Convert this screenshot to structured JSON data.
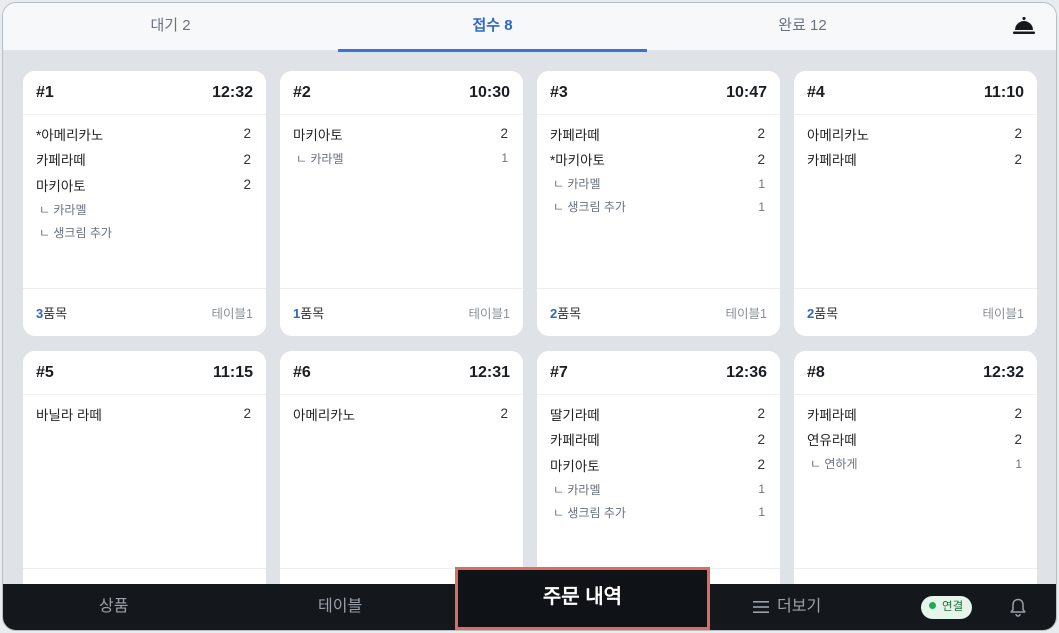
{
  "tabs": [
    {
      "label": "대기 2",
      "active": false
    },
    {
      "label": "접수 8",
      "active": true
    },
    {
      "label": "완료 12",
      "active": false
    }
  ],
  "icons": {
    "top_right": "service-bell-icon",
    "more": "menu-icon",
    "bottom_right": "bell-icon"
  },
  "colors": {
    "accent": "#2f67c4",
    "highlight_border": "#e06a5e",
    "connected": "#23a55a"
  },
  "cards": [
    {
      "no": "#1",
      "time": "12:32",
      "items": [
        {
          "name": "*아메리카노",
          "qty": "2"
        },
        {
          "name": "카페라떼",
          "qty": "2"
        },
        {
          "name": "마키아토",
          "qty": "2"
        },
        {
          "name": "ㄴ 카라멜",
          "qty": "",
          "opt": true
        },
        {
          "name": "ㄴ 생크림 추가",
          "qty": "",
          "opt": true
        }
      ],
      "count_num": "3",
      "count_unit": "품목",
      "table": "테이블1"
    },
    {
      "no": "#2",
      "time": "10:30",
      "items": [
        {
          "name": "마키아토",
          "qty": "2"
        },
        {
          "name": "ㄴ 카라멜",
          "qty": "1",
          "opt": true
        }
      ],
      "count_num": "1",
      "count_unit": "품목",
      "table": "테이블1"
    },
    {
      "no": "#3",
      "time": "10:47",
      "items": [
        {
          "name": "카페라떼",
          "qty": "2"
        },
        {
          "name": "*마키아토",
          "qty": "2"
        },
        {
          "name": "ㄴ 카라멜",
          "qty": "1",
          "opt": true
        },
        {
          "name": "ㄴ 생크림 추가",
          "qty": "1",
          "opt": true
        }
      ],
      "count_num": "2",
      "count_unit": "품목",
      "table": "테이블1"
    },
    {
      "no": "#4",
      "time": "11:10",
      "items": [
        {
          "name": "아메리카노",
          "qty": "2"
        },
        {
          "name": "카페라떼",
          "qty": "2"
        }
      ],
      "count_num": "2",
      "count_unit": "품목",
      "table": "테이블1"
    },
    {
      "no": "#5",
      "time": "11:15",
      "items": [
        {
          "name": "바닐라 라떼",
          "qty": "2"
        }
      ]
    },
    {
      "no": "#6",
      "time": "12:31",
      "items": [
        {
          "name": "아메리카노",
          "qty": "2"
        }
      ]
    },
    {
      "no": "#7",
      "time": "12:36",
      "items": [
        {
          "name": "딸기라떼",
          "qty": "2"
        },
        {
          "name": "카페라떼",
          "qty": "2"
        },
        {
          "name": "마키아토",
          "qty": "2"
        },
        {
          "name": "ㄴ 카라멜",
          "qty": "1",
          "opt": true
        },
        {
          "name": "ㄴ 생크림 추가",
          "qty": "1",
          "opt": true
        }
      ]
    },
    {
      "no": "#8",
      "time": "12:32",
      "items": [
        {
          "name": "카페라떼",
          "qty": "2"
        },
        {
          "name": "연유라떼",
          "qty": "2"
        },
        {
          "name": "ㄴ 연하게",
          "qty": "1",
          "opt": true
        }
      ]
    }
  ],
  "bottom_nav": {
    "products": "상품",
    "tables": "테이블",
    "orders": "주문 내역",
    "more": "더보기",
    "status": "연결"
  }
}
